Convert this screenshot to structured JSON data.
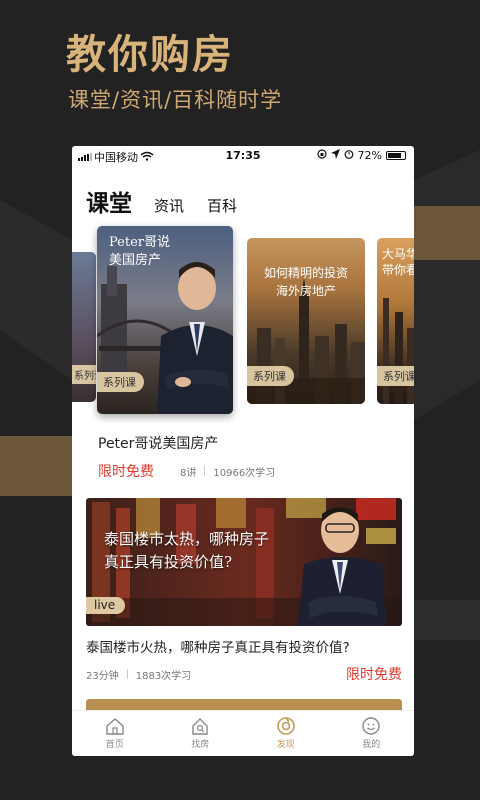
{
  "promo": {
    "title": "教你购房",
    "subtitle": "课堂/资讯/百科随时学"
  },
  "status_bar": {
    "carrier": "中国移动",
    "time": "17:35",
    "battery": "72%"
  },
  "tabs": {
    "main": "课堂",
    "items": [
      "资讯",
      "百科"
    ]
  },
  "carousel": {
    "cards": [
      {
        "title": "",
        "tag": "系列课"
      },
      {
        "title_line1": "Peter哥说",
        "title_line2": "美国房产",
        "tag": "系列课"
      },
      {
        "title_line1": "如何精明的投资",
        "title_line2": "海外房地产",
        "tag": "系列课"
      },
      {
        "title_line1": "大马华",
        "title_line2": "带你看",
        "tag": "系列课"
      }
    ]
  },
  "featured_course": {
    "title": "Peter哥说美国房产",
    "price_label": "限时免费",
    "lessons": "8讲",
    "learners": "10966次学习"
  },
  "live": {
    "banner_line1": "泰国楼市太热，哪种房子",
    "banner_line2": "真正具有投资价值?",
    "badge": "live",
    "title": "泰国楼市火热，哪种房子真正具有投资价值?",
    "duration": "23分钟",
    "learners": "1883次学习",
    "price_label": "限时免费"
  },
  "tabbar": {
    "items": [
      {
        "label": "首页",
        "icon": "home-icon"
      },
      {
        "label": "找房",
        "icon": "find-house-icon"
      },
      {
        "label": "发现",
        "icon": "discover-icon"
      },
      {
        "label": "我的",
        "icon": "profile-icon"
      }
    ],
    "active_index": 2
  },
  "colors": {
    "background": "#222222",
    "gold": "#d9b47a",
    "accent_red": "#e03a2f",
    "tab_active": "#c49a5a"
  }
}
